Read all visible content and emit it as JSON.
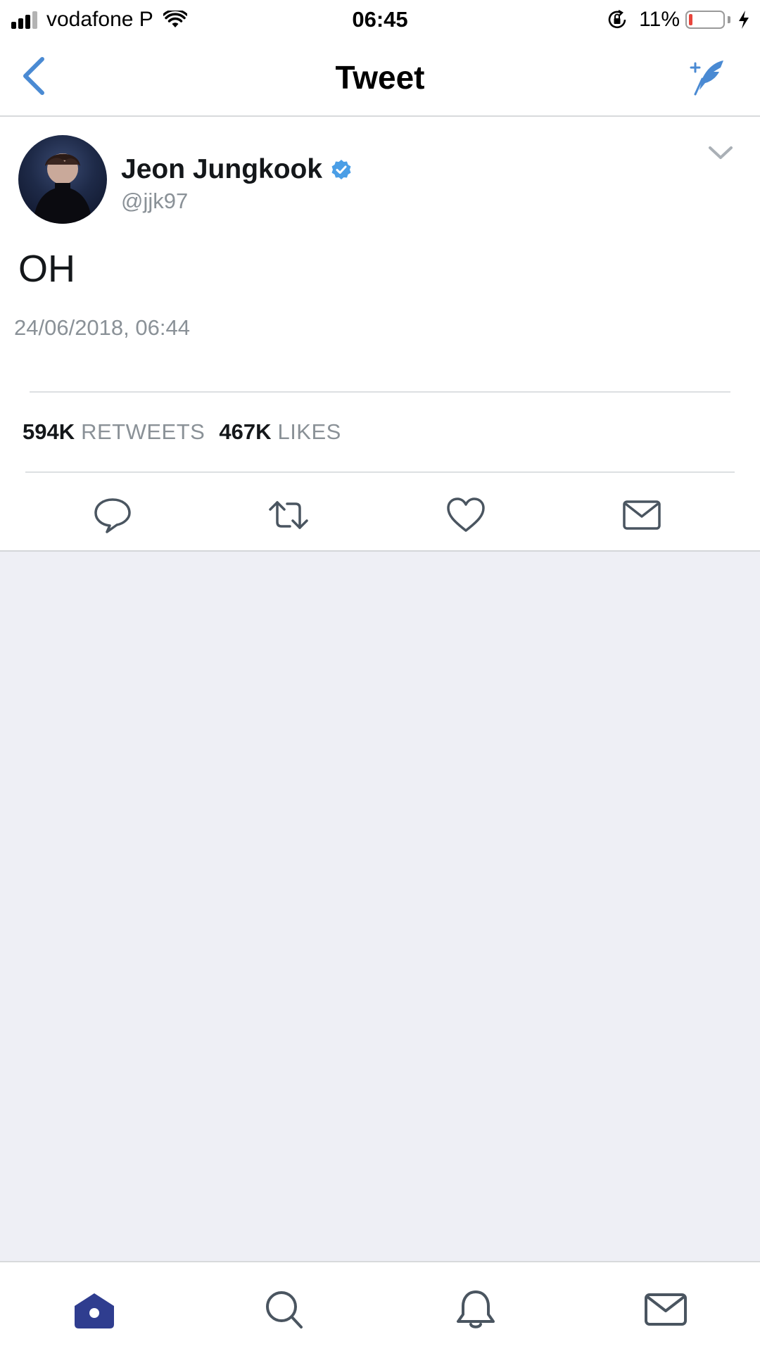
{
  "status_bar": {
    "carrier": "vodafone P",
    "time": "06:45",
    "battery_percent": "11%",
    "battery_level": 0.11,
    "battery_color": "#e8453c"
  },
  "nav": {
    "title": "Tweet",
    "back_icon": "chevron-left-icon",
    "compose_icon": "compose-tweet-icon",
    "accent_color": "#4a8ad3"
  },
  "tweet": {
    "author_name": "Jeon Jungkook",
    "verified": true,
    "handle": "@jjk97",
    "text": "OH",
    "timestamp": "24/06/2018, 06:44",
    "stats": {
      "retweets_count": "594K",
      "retweets_label": "RETWEETS",
      "likes_count": "467K",
      "likes_label": "LIKES"
    },
    "actions": [
      "reply-icon",
      "retweet-icon",
      "like-icon",
      "direct-message-icon"
    ]
  },
  "tab_bar": {
    "tabs": [
      {
        "icon": "home-icon",
        "active": true
      },
      {
        "icon": "search-icon",
        "active": false
      },
      {
        "icon": "notifications-icon",
        "active": false
      },
      {
        "icon": "messages-icon",
        "active": false
      }
    ],
    "active_color": "#2f3d8f"
  }
}
